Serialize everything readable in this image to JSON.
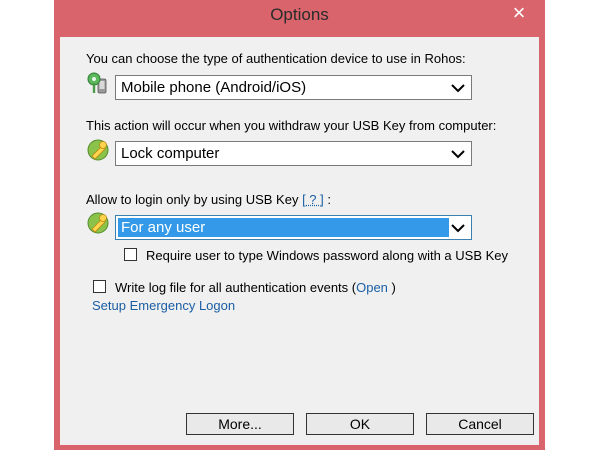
{
  "window": {
    "title": "Options",
    "close_symbol": "×"
  },
  "auth_device": {
    "label": "You can choose the type of authentication device to use in Rohos:",
    "selected": "Mobile phone (Android/iOS)",
    "icon": "phone-key-icon"
  },
  "withdraw_action": {
    "label": "This action will occur when you withdraw your USB Key from computer:",
    "selected": "Lock computer",
    "icon": "key-icon"
  },
  "login_restriction": {
    "label_prefix": "Allow to login only by using USB Key",
    "help_link": "[ ? ]",
    "label_suffix": ":",
    "selected": "For any user",
    "icon": "key-icon",
    "highlight_color": "#3399e8"
  },
  "require_password": {
    "label": "Require user to type Windows password along with a USB Key",
    "checked": false
  },
  "write_log": {
    "label_prefix": "Write log file for all authentication events (",
    "open_link": "Open",
    "label_suffix": ")",
    "checked": false
  },
  "emergency_link": "Setup Emergency Logon",
  "buttons": {
    "more": "More...",
    "ok": "OK",
    "cancel": "Cancel"
  },
  "colors": {
    "titlebar": "#d9646c",
    "link": "#1a5ea3",
    "dialog_bg": "#f0f0f0"
  }
}
